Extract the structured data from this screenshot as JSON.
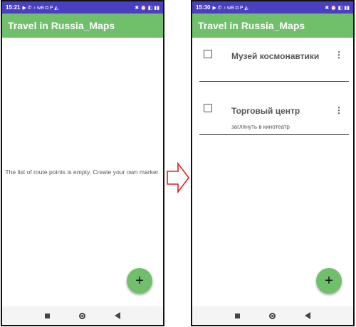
{
  "left_screen": {
    "status_time": "15:21",
    "status_icons_left": "▶ ✆ ♪ wB ◘ P ◭",
    "status_icons_right": "✱ ⏰ ◧ ▮▮",
    "app_title": "Travel in Russia_Maps",
    "empty_message": "The list of route points is empty. Create your own marker.",
    "fab_label": "+"
  },
  "right_screen": {
    "status_time": "15:30",
    "status_icons_left": "▶ ✆ ♪ wB ◘ P ◭",
    "status_icons_right": "✱ ⏰ ◧ ▮▮",
    "app_title": "Travel in Russia_Maps",
    "items": [
      {
        "title": "Музей космонавтики",
        "description": "",
        "more": "⋮"
      },
      {
        "title": "Торговый центр",
        "description": "заглянуть в кинотеатр",
        "more": "⋮"
      }
    ],
    "fab_label": "+"
  },
  "colors": {
    "status_bar": "#4a3fbf",
    "app_bar": "#6fbf6b",
    "fab": "#6fbf6b",
    "arrow": "#e02020"
  }
}
